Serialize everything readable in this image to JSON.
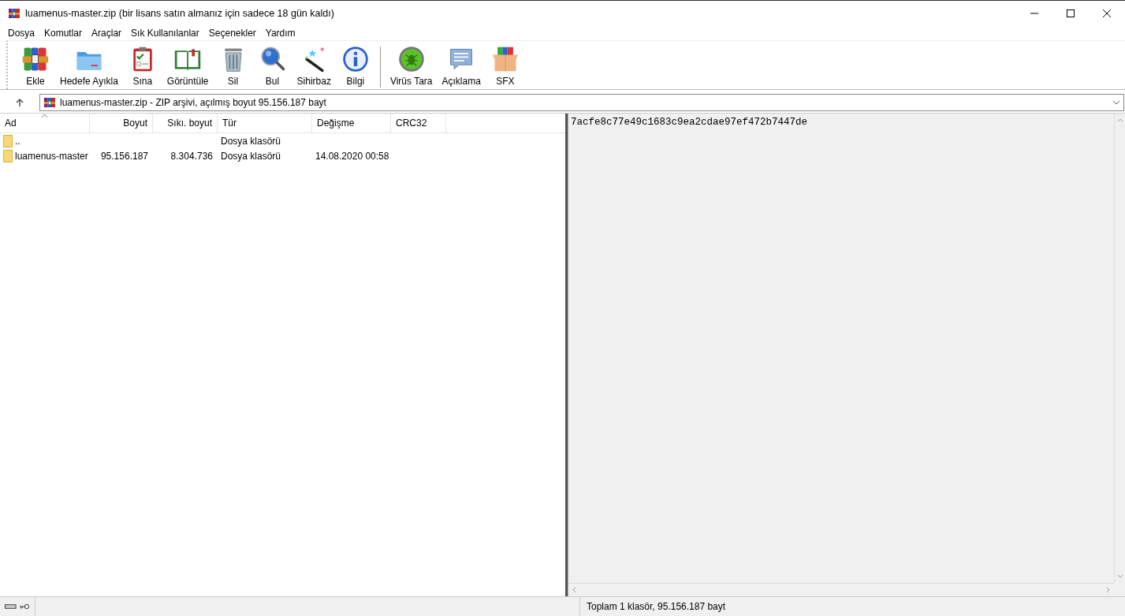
{
  "window": {
    "title": "luamenus-master.zip (bir lisans satın almanız için sadece 18 gün kaldı)"
  },
  "menu": [
    "Dosya",
    "Komutlar",
    "Araçlar",
    "Sık Kullanılanlar",
    "Seçenekler",
    "Yardım"
  ],
  "toolbar": {
    "groups": [
      [
        "Ekle",
        "Hedefe Ayıkla",
        "Sına",
        "Görüntüle",
        "Sil",
        "Bul",
        "Sihirbaz",
        "Bilgi"
      ],
      [
        "Virüs Tara",
        "Açıklama",
        "SFX"
      ]
    ]
  },
  "address": {
    "value": "luamenus-master.zip - ZIP arşivi, açılmış boyut 95.156.187 bayt"
  },
  "table": {
    "columns": [
      {
        "label": "Ad",
        "sorted": true
      },
      {
        "label": "Boyut",
        "sorted": false
      },
      {
        "label": "Sıkı. boyut",
        "sorted": false
      },
      {
        "label": "Tür",
        "sorted": false
      },
      {
        "label": "Değişme",
        "sorted": false
      },
      {
        "label": "CRC32",
        "sorted": false
      }
    ],
    "rows": [
      {
        "kind": "folder",
        "cells": [
          "..",
          "",
          "",
          "Dosya klasörü",
          "",
          ""
        ]
      },
      {
        "kind": "folder",
        "cells": [
          "luamenus-master",
          "95.156.187",
          "8.304.736",
          "Dosya klasörü",
          "14.08.2020 00:58",
          ""
        ]
      }
    ]
  },
  "comment": {
    "text": "7acfe8c77e49c1683c9ea2cdae97ef472b7447de"
  },
  "status_bar": {
    "text": "Toplam 1 klasör, 95.156.187 bayt"
  }
}
